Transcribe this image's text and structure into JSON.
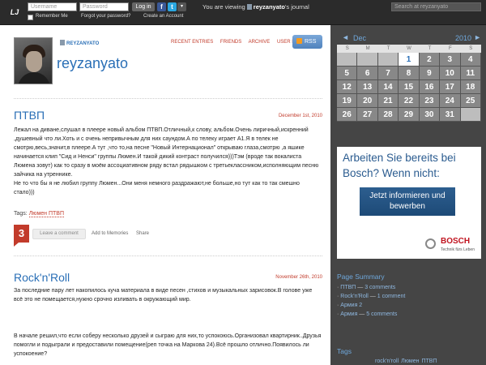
{
  "topbar": {
    "logo": "LJ",
    "username_placeholder": "Username",
    "password_placeholder": "Password",
    "login_label": "Log in",
    "fb_icon": "f",
    "tw_icon": "t",
    "dropdown_icon": "▾",
    "remember": "Remember Me",
    "forgot": "Forgot your password?",
    "create": "Create an Account",
    "viewing_prefix": "You are viewing",
    "viewing_user": "reyzanyato",
    "viewing_suffix": "'s journal",
    "search_placeholder": "Search at reyzanyato"
  },
  "journal": {
    "username_small": "REYZANYATO",
    "title": "reyzanyato",
    "nav": [
      "RECENT ENTRIES",
      "FRIENDS",
      "ARCHIVE",
      "USER INFO"
    ],
    "rss_label": "RSS"
  },
  "posts": [
    {
      "title": "ПТВП",
      "date": "December 1st, 2010",
      "paragraphs": [
        " Лежал на диване,слушал в плеере новый альбом ПТВП.Отличный,к слову, альбом.Очень лиричный,искренний ,душевный что ли.Хоть и с очень непривычным для них саундом.А по телеку играет А1.Я в телек не смотрю,весь,значит,в плеере.А тут ,что то,на песне \"Новый Интернационал\" открываю глаза,смотрю ,а яшике начинается клип \"Сид и Ненси\" группы Люмен.И такой дикий контраст получился)))Тэм (вроде так вокалиста Люмена зовут) как то сразу в моём ассоциативном ряду встал рядышком с третьеклассником,исполняющим песню зайчика на утреннике.",
        " Не то что бы я не любил группу Люмен...Они меня немного раздражают,не больше,но тут как то так смешно стало)))"
      ],
      "tags_label": "Tags:",
      "tags": "Люмен ПТВП",
      "comments": "3",
      "leave_comment": "Leave a comment",
      "memories": "Add to Memories",
      "share": "Share"
    },
    {
      "title": "Rock'n'Roll",
      "date": "November 26th, 2010",
      "paragraphs": [
        "   За последние пару лет накопилось куча материала в виде песен ,стихов и музыкальных зарисовок.В голове уже всё это не помещается,нужно срочно изливать в окружающий мир.",
        "В начале решил,что если соберу несколько друзей и сыграю для них,то успокоюсь.Организовал квартирник..Друзья помогли и подыграли и предоставили помещение(реп точка на Маркова 24).Всё прошло отлично.Появилось ли успокоение?"
      ]
    }
  ],
  "calendar": {
    "month": "Dec",
    "year": "2010",
    "prev_icon": "◄",
    "next_icon": "►",
    "days": [
      "S",
      "M",
      "T",
      "W",
      "T",
      "F",
      "S"
    ],
    "weeks": [
      [
        "",
        "",
        "",
        "1",
        "2",
        "3",
        "4"
      ],
      [
        "5",
        "6",
        "7",
        "8",
        "9",
        "10",
        "11"
      ],
      [
        "12",
        "13",
        "14",
        "15",
        "16",
        "17",
        "18"
      ],
      [
        "19",
        "20",
        "21",
        "22",
        "23",
        "24",
        "25"
      ],
      [
        "26",
        "27",
        "28",
        "29",
        "30",
        "31",
        ""
      ]
    ],
    "highlight": "1"
  },
  "ad": {
    "text": "Arbeiten Sie bereits bei Bosch? Wenn nicht:",
    "button": "Jetzt informieren und bewerben",
    "brand": "BOSCH",
    "slogan": "Technik fürs Leben"
  },
  "page_summary": {
    "title": "Page Summary",
    "items": [
      {
        "title": "ПТВП",
        "sep": " — ",
        "count": "3 comments"
      },
      {
        "title": "Rock'n'Roll",
        "sep": " — ",
        "count": "1 comment"
      },
      {
        "title": "Армия 2",
        "sep": "",
        "count": ""
      },
      {
        "title": "Армия",
        "sep": " — ",
        "count": "5 comments"
      }
    ]
  },
  "tags_section": {
    "title": "Tags",
    "cloud": [
      "rock'n'roll",
      "Люмен",
      "ПТВП"
    ]
  }
}
